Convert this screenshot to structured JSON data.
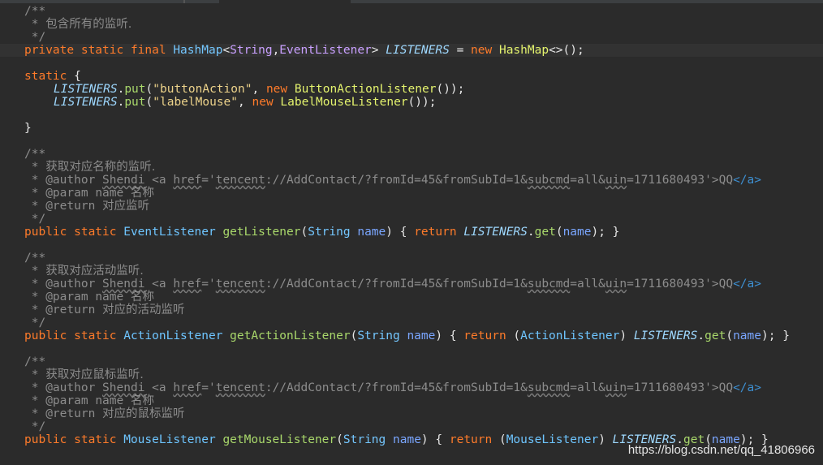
{
  "watermark": "https://blog.csdn.net/qq_41806966",
  "code": {
    "c1_open": "/**",
    "c1_star": " * ",
    "c1_text": "包含所有的监听.",
    "c1_close": " */",
    "l_field_private": "private static final ",
    "l_field_hashmap": "HashMap",
    "l_field_lt": "<",
    "l_field_string": "String",
    "l_field_comma": ",",
    "l_field_eventlistener": "EventListener",
    "l_field_gt": ">",
    "l_field_name": "LISTENERS",
    "l_field_eq": " = ",
    "l_field_new": "new ",
    "l_field_hashmap2": "HashMap",
    "l_field_end": "<>();",
    "static_kw": "static",
    "static_brace": " {",
    "put1_field": "LISTENERS",
    "put1_dot": ".",
    "put1_method": "put",
    "put1_paren": "(",
    "put1_str": "\"buttonAction\"",
    "put1_comma": ", ",
    "put1_new": "new ",
    "put1_class": "ButtonActionListener",
    "put1_end": "());",
    "put2_field": "LISTENERS",
    "put2_dot": ".",
    "put2_method": "put",
    "put2_paren": "(",
    "put2_str": "\"labelMouse\"",
    "put2_comma": ", ",
    "put2_new": "new ",
    "put2_class": "LabelMouseListener",
    "put2_end": "());",
    "static_close": "}",
    "c2_text": "获取对应名称的监听.",
    "c3_text": "获取对应活动监听.",
    "c4_text": "获取对应鼠标监听.",
    "author_tag": "@author ",
    "author_name": "Shendi",
    "author_a_open": " <a ",
    "author_href": "href",
    "author_eq": "='",
    "author_tencent": "tencent",
    "author_url1": "://AddContact/?fromId=45&fromSubId=1&",
    "author_subcmd": "subcmd",
    "author_url2": "=all&",
    "author_uin": "uin",
    "author_url3": "=1711680493'>QQ",
    "author_a_close": "</a>",
    "param_tag": "@param ",
    "param_name": "name ",
    "param_text": "名称",
    "return_tag": "@return ",
    "r2_text": "对应监听",
    "r3_text": "对应的活动监听",
    "r4_text": "对应的鼠标监听",
    "pub": "public static ",
    "m1_type": "EventListener",
    "m1_name": "getListener",
    "m2_type": "ActionListener",
    "m2_name": "getActionListener",
    "m3_type": "MouseListener",
    "m3_name": "getMouseListener",
    "sig_open": "(",
    "sig_string": "String",
    "sig_param": "name",
    "sig_close": ")",
    "sig_brace": " { ",
    "ret_kw": "return ",
    "cast2_open": "(",
    "cast2_type": "ActionListener",
    "cast2_close": ") ",
    "cast3_open": "(",
    "cast3_type": "MouseListener",
    "cast3_close": ") ",
    "ret_field": "LISTENERS",
    "ret_dot": ".",
    "ret_get": "get",
    "ret_paren": "(",
    "ret_arg": "name",
    "ret_end": "); }"
  }
}
